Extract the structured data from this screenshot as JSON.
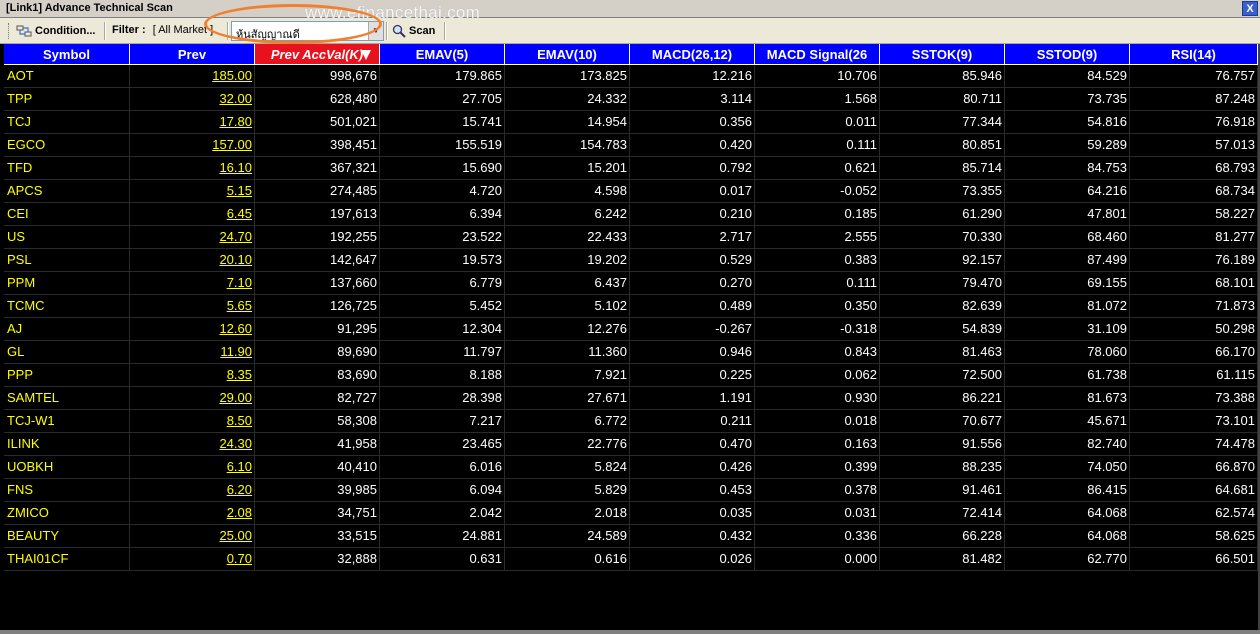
{
  "window": {
    "title": "[Link1] Advance Technical Scan",
    "close_label": "X",
    "watermark": "www.efinancethai.com"
  },
  "toolbar": {
    "condition_label": "Condition...",
    "filter_label": "Filter :",
    "filter_value": "[ All Market ]",
    "combo_value": "หุ้นสัญญาณดี",
    "scan_label": "Scan"
  },
  "icons": {
    "condition": "condition-icon",
    "scan": "magnifier-icon",
    "sort": "sort-down-triangle-icon"
  },
  "colors": {
    "header_bg": "#0000ff",
    "sorted_header_bg": "#e8121e",
    "symbol_text": "#ffff00",
    "value_text": "#ffffff",
    "grid_bg": "#000000",
    "highlight_ring": "#f08030"
  },
  "table": {
    "columns": [
      "Symbol",
      "Prev",
      "Prev AccVal(K)",
      "EMAV(5)",
      "EMAV(10)",
      "MACD(26,12)",
      "MACD Signal(26",
      "SSTOK(9)",
      "SSTOD(9)",
      "RSI(14)"
    ],
    "sorted_column": 2,
    "rows": [
      [
        "AOT",
        "185.00",
        "998,676",
        "179.865",
        "173.825",
        "12.216",
        "10.706",
        "85.946",
        "84.529",
        "76.757"
      ],
      [
        "TPP",
        "32.00",
        "628,480",
        "27.705",
        "24.332",
        "3.114",
        "1.568",
        "80.711",
        "73.735",
        "87.248"
      ],
      [
        "TCJ",
        "17.80",
        "501,021",
        "15.741",
        "14.954",
        "0.356",
        "0.011",
        "77.344",
        "54.816",
        "76.918"
      ],
      [
        "EGCO",
        "157.00",
        "398,451",
        "155.519",
        "154.783",
        "0.420",
        "0.111",
        "80.851",
        "59.289",
        "57.013"
      ],
      [
        "TFD",
        "16.10",
        "367,321",
        "15.690",
        "15.201",
        "0.792",
        "0.621",
        "85.714",
        "84.753",
        "68.793"
      ],
      [
        "APCS",
        "5.15",
        "274,485",
        "4.720",
        "4.598",
        "0.017",
        "-0.052",
        "73.355",
        "64.216",
        "68.734"
      ],
      [
        "CEI",
        "6.45",
        "197,613",
        "6.394",
        "6.242",
        "0.210",
        "0.185",
        "61.290",
        "47.801",
        "58.227"
      ],
      [
        "US",
        "24.70",
        "192,255",
        "23.522",
        "22.433",
        "2.717",
        "2.555",
        "70.330",
        "68.460",
        "81.277"
      ],
      [
        "PSL",
        "20.10",
        "142,647",
        "19.573",
        "19.202",
        "0.529",
        "0.383",
        "92.157",
        "87.499",
        "76.189"
      ],
      [
        "PPM",
        "7.10",
        "137,660",
        "6.779",
        "6.437",
        "0.270",
        "0.111",
        "79.470",
        "69.155",
        "68.101"
      ],
      [
        "TCMC",
        "5.65",
        "126,725",
        "5.452",
        "5.102",
        "0.489",
        "0.350",
        "82.639",
        "81.072",
        "71.873"
      ],
      [
        "AJ",
        "12.60",
        "91,295",
        "12.304",
        "12.276",
        "-0.267",
        "-0.318",
        "54.839",
        "31.109",
        "50.298"
      ],
      [
        "GL",
        "11.90",
        "89,690",
        "11.797",
        "11.360",
        "0.946",
        "0.843",
        "81.463",
        "78.060",
        "66.170"
      ],
      [
        "PPP",
        "8.35",
        "83,690",
        "8.188",
        "7.921",
        "0.225",
        "0.062",
        "72.500",
        "61.738",
        "61.115"
      ],
      [
        "SAMTEL",
        "29.00",
        "82,727",
        "28.398",
        "27.671",
        "1.191",
        "0.930",
        "86.221",
        "81.673",
        "73.388"
      ],
      [
        "TCJ-W1",
        "8.50",
        "58,308",
        "7.217",
        "6.772",
        "0.211",
        "0.018",
        "70.677",
        "45.671",
        "73.101"
      ],
      [
        "ILINK",
        "24.30",
        "41,958",
        "23.465",
        "22.776",
        "0.470",
        "0.163",
        "91.556",
        "82.740",
        "74.478"
      ],
      [
        "UOBKH",
        "6.10",
        "40,410",
        "6.016",
        "5.824",
        "0.426",
        "0.399",
        "88.235",
        "74.050",
        "66.870"
      ],
      [
        "FNS",
        "6.20",
        "39,985",
        "6.094",
        "5.829",
        "0.453",
        "0.378",
        "91.461",
        "86.415",
        "64.681"
      ],
      [
        "ZMICO",
        "2.08",
        "34,751",
        "2.042",
        "2.018",
        "0.035",
        "0.031",
        "72.414",
        "64.068",
        "62.574"
      ],
      [
        "BEAUTY",
        "25.00",
        "33,515",
        "24.881",
        "24.589",
        "0.432",
        "0.336",
        "66.228",
        "64.068",
        "58.625"
      ],
      [
        "THAI01CF",
        "0.70",
        "32,888",
        "0.631",
        "0.616",
        "0.026",
        "0.000",
        "81.482",
        "62.770",
        "66.501"
      ]
    ]
  }
}
